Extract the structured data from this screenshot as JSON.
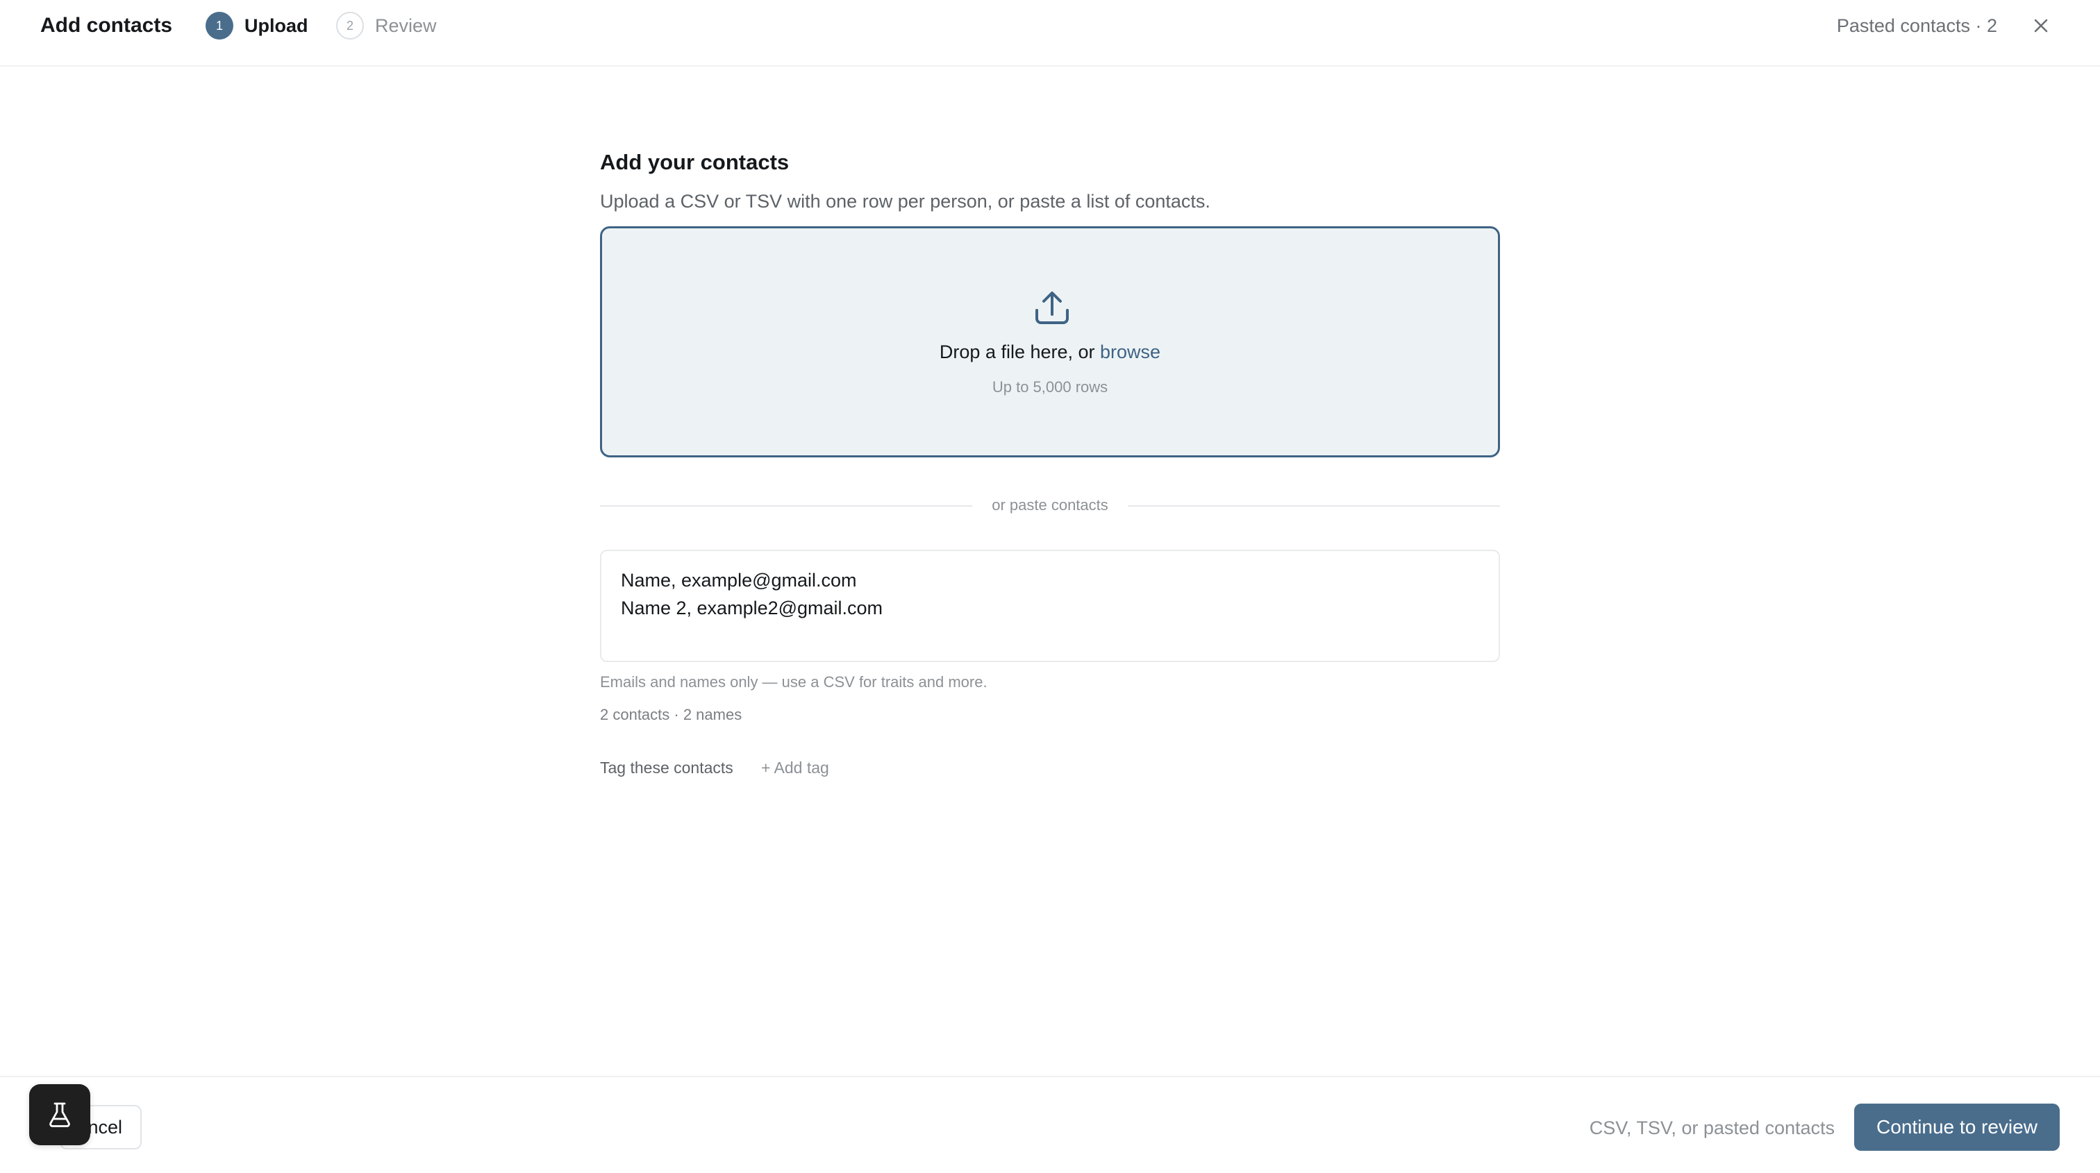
{
  "header": {
    "title": "Add contacts",
    "steps": [
      {
        "number": "1",
        "label": "Upload",
        "state": "active"
      },
      {
        "number": "2",
        "label": "Review",
        "state": "inactive"
      }
    ],
    "pasted_status": "Pasted contacts · 2",
    "close_icon": "close-icon"
  },
  "main": {
    "title": "Add your contacts",
    "subtitle": "Upload a CSV or TSV with one row per person, or paste a list of contacts.",
    "dropzone": {
      "icon": "upload-icon",
      "text": "Drop a file here, or ",
      "browse_label": "browse",
      "hint": "Up to 5,000 rows"
    },
    "divider_label": "or paste contacts",
    "paste": {
      "lines": [
        "Name, example@gmail.com",
        "Name 2, example2@gmail.com"
      ],
      "hint": "Emails and names only — use a CSV for traits and more.",
      "count": "2 contacts · 2 names"
    },
    "tags": {
      "label": "Tag these contacts",
      "add_label": "+ Add tag"
    }
  },
  "footer": {
    "cancel_label": "ncel",
    "hint": "CSV, TSV, or pasted contacts",
    "continue_label": "Continue to review",
    "floating_icon": "flask-icon"
  },
  "colors": {
    "accent": "#4a6d8c",
    "dropzone_bg": "#edf3f5",
    "dropzone_border": "#3f6385"
  }
}
